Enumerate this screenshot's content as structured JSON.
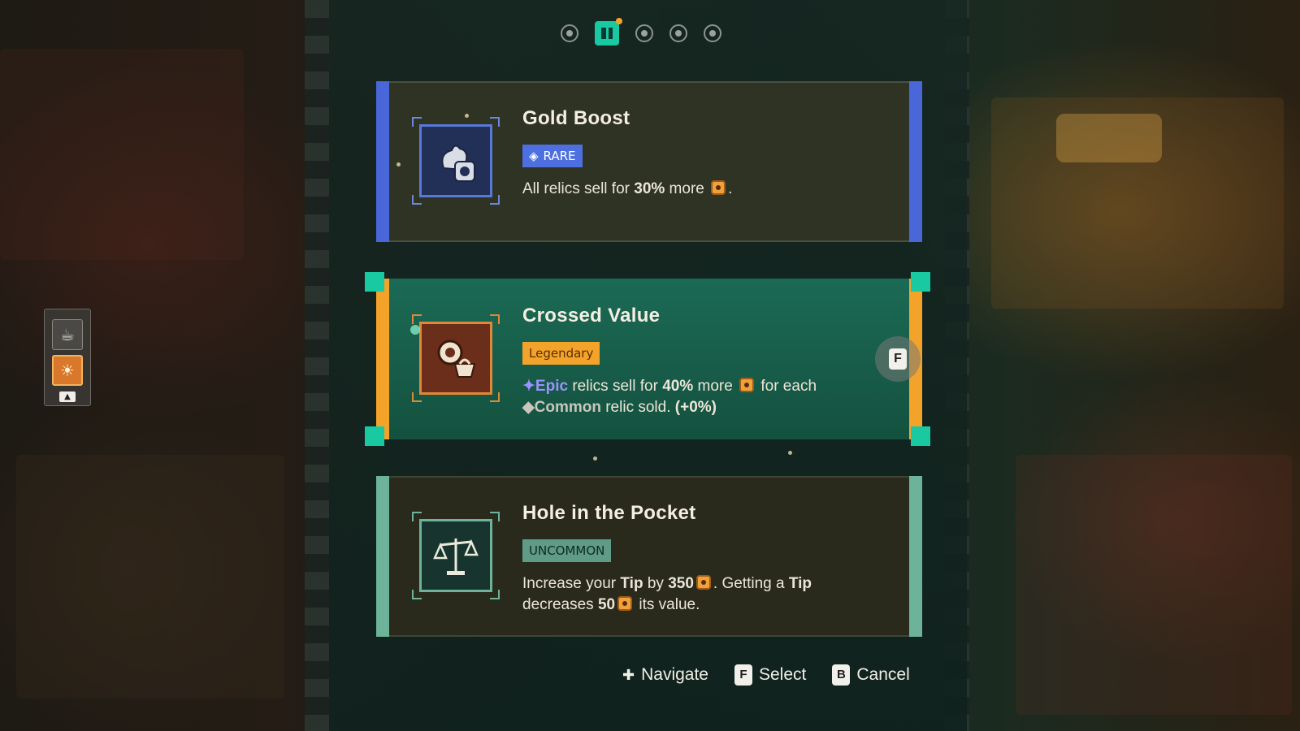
{
  "page_dots": [
    {
      "label": "page-1",
      "active": false
    },
    {
      "label": "page-2",
      "active": true
    },
    {
      "label": "page-3",
      "active": false
    },
    {
      "label": "page-4",
      "active": false
    },
    {
      "label": "page-5",
      "active": false
    }
  ],
  "cards": [
    {
      "title": "Gold Boost",
      "rarity": "RARE",
      "rarity_icon": "rare-diamond-icon",
      "icon": "teapot-coin-icon",
      "desc_parts": [
        "All relics sell for ",
        "30%",
        " more ",
        "."
      ],
      "colors": {
        "rail": "#4a67d9",
        "badge_bg": "#4d6fe0",
        "icon_bg": "#223058",
        "icon_border": "#5879d8"
      }
    },
    {
      "title": "Crossed Value",
      "rarity": "Legendary",
      "icon": "wreath-basket-icon",
      "line1": {
        "tag": "Epic",
        "a": " relics sell for ",
        "pct": "40%",
        "b": " more ",
        "c": " for each"
      },
      "line2": {
        "tag": "Common",
        "a": " relic sold. ",
        "bonus": "(+0%)"
      },
      "colors": {
        "rail": "#f4a32a",
        "corner": "#19c9a2",
        "badge_bg": "#f4a32a",
        "badge_fg": "#5a2d05",
        "icon_bg": "#6a2e1b",
        "icon_border": "#e0883a",
        "epic": "#9b93ff",
        "common": "#c9c6bd"
      }
    },
    {
      "title": "Hole in the Pocket",
      "rarity": "UNCOMMON",
      "icon": "scales-icon",
      "line1": {
        "a": "Increase your ",
        "tip": "Tip",
        "b": " by ",
        "num": "350",
        "c": ". Getting a ",
        "tip2": "Tip"
      },
      "line2": {
        "a": "decreases ",
        "num": "50",
        "b": " its value."
      },
      "colors": {
        "rail": "#6db39a",
        "badge_bg": "#5f9b86",
        "badge_fg": "#0f2a22",
        "icon_bg": "#17352e",
        "icon_border": "#6db39a"
      }
    }
  ],
  "footer": {
    "navigate": "Navigate",
    "select_key": "F",
    "select": "Select",
    "cancel_key": "B",
    "cancel": "Cancel"
  },
  "f_badge": "F"
}
